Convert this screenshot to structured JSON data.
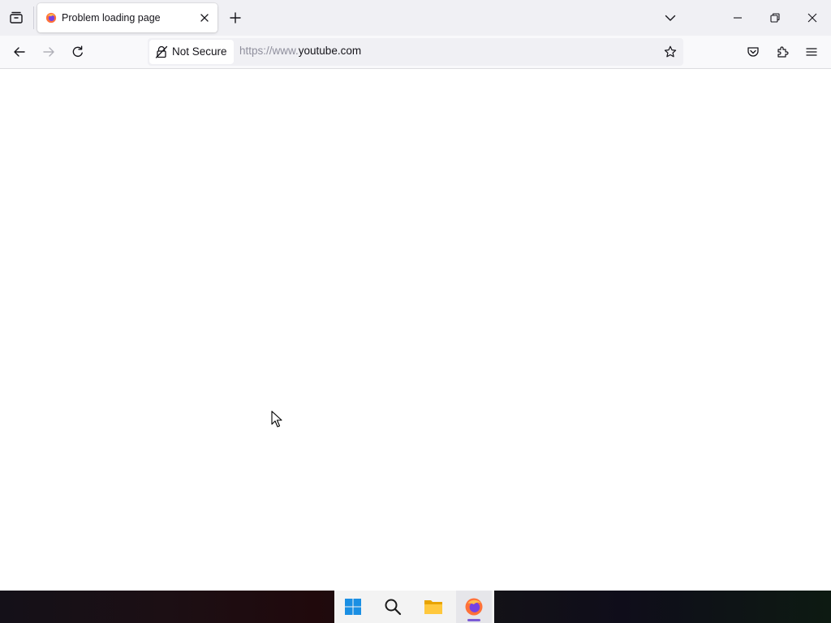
{
  "browser": {
    "tab": {
      "title": "Problem loading page",
      "favicon": "firefox-icon"
    },
    "toolbar": {
      "security_label": "Not Secure",
      "url_prefix": "https://www.",
      "url_host": "youtube.com"
    }
  },
  "icons": {
    "tab_overview": "tab-overview-icon",
    "close_tab": "close-icon",
    "new_tab": "plus-icon",
    "list_all_tabs": "chevron-down-icon",
    "minimize": "minimize-icon",
    "maximize": "restore-icon",
    "close_window": "close-icon",
    "back": "arrow-left-icon",
    "forward": "arrow-right-icon",
    "reload": "reload-icon",
    "lock": "lock-warning-icon",
    "bookmark": "star-icon",
    "pocket": "pocket-icon",
    "extensions": "puzzle-icon",
    "menu": "hamburger-icon"
  },
  "taskbar": {
    "apps": [
      "start-icon",
      "search-icon",
      "file-explorer-icon",
      "firefox-icon"
    ],
    "active_app": "firefox-icon"
  },
  "colors": {
    "accent": "#7a5bd6",
    "tabbar_bg": "#f0f0f4",
    "navbar_bg": "#f9f9fb"
  }
}
